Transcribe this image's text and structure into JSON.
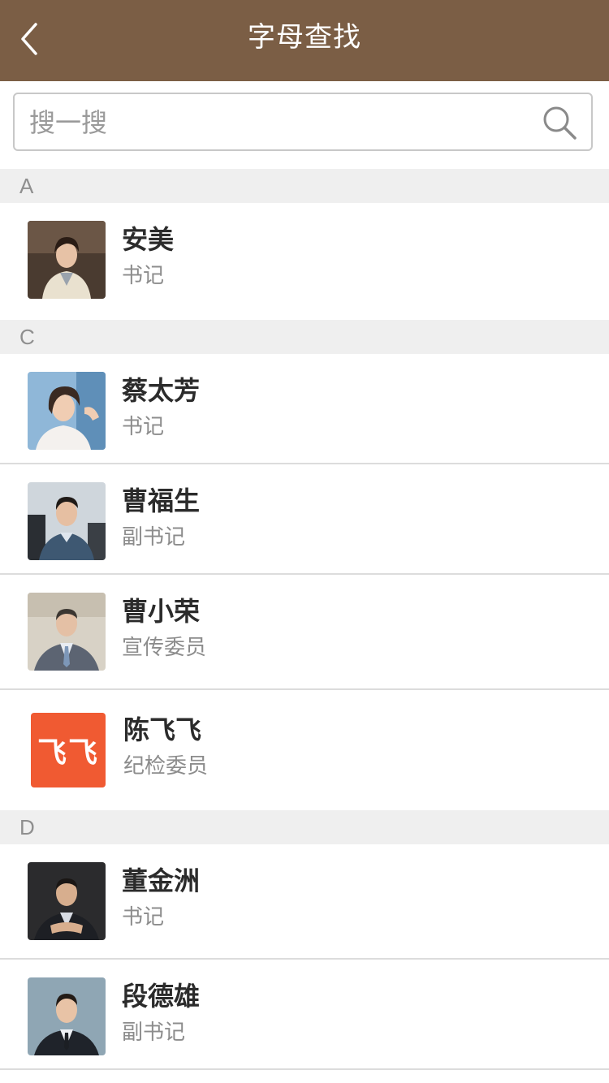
{
  "header": {
    "title": "字母查找",
    "back_icon": "chevron-left-icon"
  },
  "search": {
    "placeholder": "搜一搜",
    "value": "",
    "icon": "search-icon"
  },
  "colors": {
    "header_bg": "#7b5e45",
    "section_bg": "#efefef",
    "logo_bg": "#f05a32"
  },
  "sections": [
    {
      "letter": "A",
      "contacts": [
        {
          "name": "安美",
          "role": "书记"
        }
      ]
    },
    {
      "letter": "C",
      "contacts": [
        {
          "name": "蔡太芳",
          "role": "书记"
        },
        {
          "name": "曹福生",
          "role": "副书记"
        },
        {
          "name": "曹小荣",
          "role": "宣传委员"
        },
        {
          "name": "陈飞飞",
          "role": "纪检委员",
          "logo_text": "飞飞"
        }
      ]
    },
    {
      "letter": "D",
      "contacts": [
        {
          "name": "董金洲",
          "role": "书记"
        },
        {
          "name": "段德雄",
          "role": "副书记"
        }
      ]
    }
  ]
}
